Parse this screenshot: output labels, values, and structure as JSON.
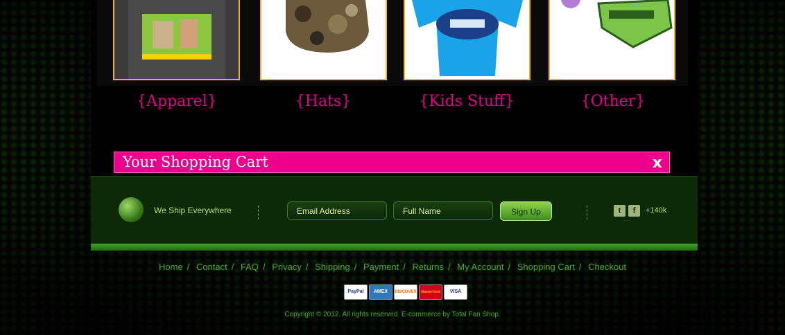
{
  "categories": [
    {
      "label": "{Apparel}"
    },
    {
      "label": "{Hats}"
    },
    {
      "label": "{Kids Stuff}"
    },
    {
      "label": "{Other}"
    }
  ],
  "cart": {
    "title": "Your Shopping Cart",
    "close": "x"
  },
  "footer": {
    "ship_text": "We Ship Everywhere",
    "email_placeholder": "Email Address",
    "name_placeholder": "Full Name",
    "signup_label": "Sign Up",
    "followers": "+140k",
    "social": [
      "twitter-icon",
      "facebook-icon"
    ]
  },
  "nav": [
    "Home",
    "Contact",
    "FAQ",
    "Privacy",
    "Shipping",
    "Payment",
    "Returns",
    "My Account",
    "Shopping Cart",
    "Checkout"
  ],
  "payments": [
    "PayPal",
    "AMEX",
    "DISCOVER",
    "MasterCard",
    "VISA"
  ],
  "copyright": "Copyright © 2012. All rights reserved. E-commerce by Total Fan Shop.",
  "colors": {
    "accent": "#ec008c",
    "link": "#4caf2a",
    "panel": "#0d2a08"
  }
}
